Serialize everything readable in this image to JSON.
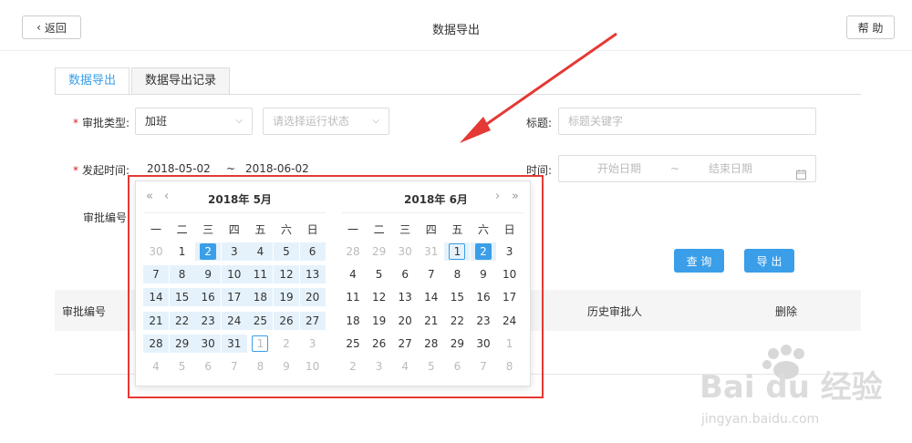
{
  "header": {
    "back_label": "返回",
    "title": "数据导出",
    "help_label": "帮 助"
  },
  "tabs": [
    {
      "label": "数据导出",
      "active": true
    },
    {
      "label": "数据导出记录",
      "active": false
    }
  ],
  "form": {
    "approval_type_label": "审批类型:",
    "approval_type_value": "加班",
    "status_placeholder": "请选择运行状态",
    "title_label": "标题:",
    "title_placeholder": "标题关键字",
    "start_time_label": "发起时间:",
    "start_date": "2018-05-02",
    "range_sep": "~",
    "end_date": "2018-06-02",
    "time_label": "时间:",
    "start_placeholder": "开始日期",
    "end_placeholder": "结束日期",
    "approval_no_label": "审批编号:"
  },
  "buttons": {
    "query": "查 询",
    "export": "导 出"
  },
  "table": {
    "headers": [
      "审批编号",
      "历史审批人",
      "删除"
    ]
  },
  "calendar": {
    "weekdays": [
      "一",
      "二",
      "三",
      "四",
      "五",
      "六",
      "日"
    ],
    "nav": {
      "prev_year": "«",
      "prev_month": "‹",
      "next_month": "›",
      "next_year": "»"
    },
    "months": [
      {
        "title": "2018年 5月",
        "weeks": [
          [
            "30",
            "1",
            "2",
            "3",
            "4",
            "5",
            "6"
          ],
          [
            "7",
            "8",
            "9",
            "10",
            "11",
            "12",
            "13"
          ],
          [
            "14",
            "15",
            "16",
            "17",
            "18",
            "19",
            "20"
          ],
          [
            "21",
            "22",
            "23",
            "24",
            "25",
            "26",
            "27"
          ],
          [
            "28",
            "29",
            "30",
            "31",
            "1",
            "2",
            "3"
          ],
          [
            "4",
            "5",
            "6",
            "7",
            "8",
            "9",
            "10"
          ]
        ],
        "muted_before": 1,
        "muted_after_index": 32,
        "range_start_index": 2,
        "range_end_index": 31,
        "selected_index": 2,
        "today_index": 32
      },
      {
        "title": "2018年 6月",
        "weeks": [
          [
            "28",
            "29",
            "30",
            "31",
            "1",
            "2",
            "3"
          ],
          [
            "4",
            "5",
            "6",
            "7",
            "8",
            "9",
            "10"
          ],
          [
            "11",
            "12",
            "13",
            "14",
            "15",
            "16",
            "17"
          ],
          [
            "18",
            "19",
            "20",
            "21",
            "22",
            "23",
            "24"
          ],
          [
            "25",
            "26",
            "27",
            "28",
            "29",
            "30",
            "1"
          ],
          [
            "2",
            "3",
            "4",
            "5",
            "6",
            "7",
            "8"
          ]
        ],
        "muted_before": 4,
        "muted_after_index": 34,
        "range_start_index": 4,
        "range_end_index": 5,
        "selected_index": 5,
        "today_index": 4
      }
    ]
  },
  "colors": {
    "accent": "#3a9ee8",
    "highlight_box": "#e53935",
    "range_bg": "#e6f2fb"
  },
  "watermark": {
    "brand": "Bai du 经验",
    "url": "jingyan.baidu.com"
  }
}
